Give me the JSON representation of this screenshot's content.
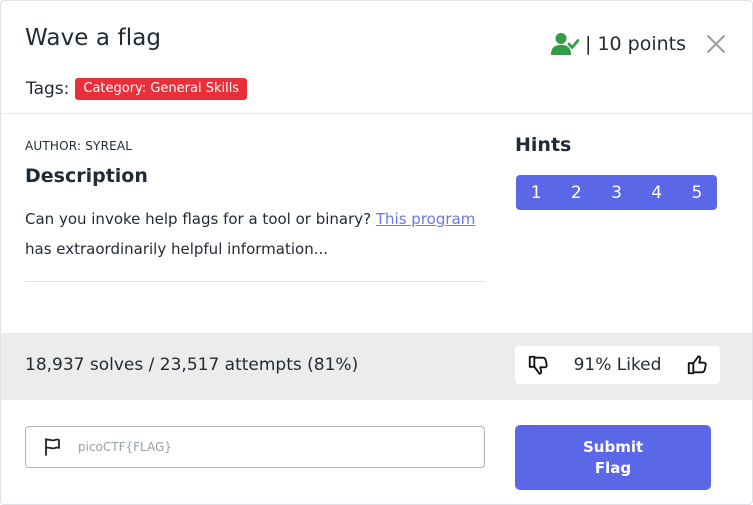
{
  "challenge": {
    "title": "Wave a flag",
    "points": "| 10 points",
    "tags_label": "Tags:",
    "tag": "Category: General Skills",
    "author": "AUTHOR: SYREAL",
    "description_heading": "Description",
    "description_pre": "Can you invoke help flags for a tool or binary? ",
    "description_link": "This program",
    "description_post": "has extraordinarily helpful information..."
  },
  "hints": {
    "heading": "Hints",
    "items": [
      "1",
      "2",
      "3",
      "4",
      "5"
    ]
  },
  "stats": {
    "solves": "18,937 solves / 23,517 attempts (81%)",
    "liked": "91% Liked"
  },
  "submit": {
    "placeholder": "picoCTF{FLAG}",
    "button_label": "Submit Flag"
  },
  "colors": {
    "accent": "#5a68e8",
    "tag": "#e8303a",
    "solved_icon": "#2f9e44"
  },
  "icons": {
    "solved": "user-check-icon",
    "close": "close-icon",
    "dislike": "thumbs-down-icon",
    "like": "thumbs-up-icon",
    "flag": "flag-icon"
  }
}
